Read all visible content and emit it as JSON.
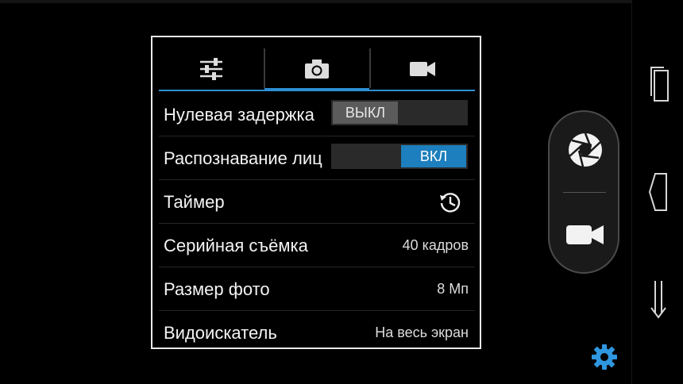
{
  "tabs": [
    {
      "label": "",
      "icon": "sliders-icon"
    },
    {
      "label": "",
      "icon": "camera-icon",
      "active": true
    },
    {
      "label": "",
      "icon": "video-camera-icon"
    }
  ],
  "settings": {
    "zero_shutter_lag": {
      "label": "Нулевая задержка",
      "toggle_off": "ВЫКЛ",
      "state": "off"
    },
    "face_detection": {
      "label": "Распознавание лиц",
      "toggle_on": "ВКЛ",
      "state": "on"
    },
    "timer": {
      "label": "Таймер",
      "icon": "timer-icon"
    },
    "burst": {
      "label": "Серийная съёмка",
      "value": "40 кадров"
    },
    "photo_size": {
      "label": "Размер фото",
      "value": "8 Мп"
    },
    "viewfinder": {
      "label": "Видоискатель",
      "value": "На весь экран"
    }
  },
  "controls": {
    "shutter_icon": "aperture-icon",
    "video_icon": "video-record-icon",
    "settings_icon": "gear-icon"
  },
  "nav": [
    "recent-apps-icon",
    "home-icon",
    "back-icon"
  ],
  "colors": {
    "accent": "#2e8fd4",
    "toggle_on": "#1d7fbd",
    "toggle_off": "#5b5b5b"
  }
}
